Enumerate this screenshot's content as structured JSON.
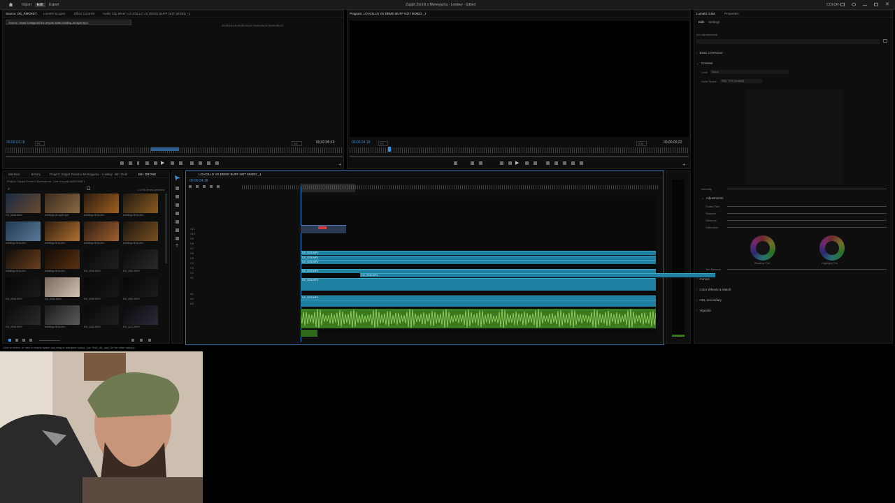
{
  "topbar": {
    "menu": [
      "Import",
      "Edit",
      "Export"
    ],
    "active_menu": "Edit",
    "title": "Zappit Zonnit x Moneyjuma - Lowkey - Edited",
    "right_label": "COLOR"
  },
  "source_monitor": {
    "tabs": [
      "Source: DB_RMOKEY",
      "Lumetri Scopes",
      "Effect Controls",
      "Audio Clip Mixer: LO KOLLO VS DEMO BUFF NOT MIXED _1"
    ],
    "active_tab": "Source: DB_RMOKEY",
    "path": "Source: visual footage/all-the-empire-state-building-at-night.mp4",
    "top_timecodes": "00;00;04;16   00;00;04;20   00;00;04;24   00;00;05;02",
    "timecode_left": "00;02;03;18",
    "fit": "Fit",
    "fraction": "1/4",
    "timecode_right": "00;02;05;13"
  },
  "program_monitor": {
    "tab": "Program: LO KOLLO VS DEMO BUFF NOT MIXED _1",
    "timecode_left": "00;00;24;18",
    "fit": "Fit",
    "fraction": "Full",
    "timecode_right": "00;00;00;22"
  },
  "lumetri": {
    "tabs": [
      "Lumetri Color",
      "Properties"
    ],
    "subtabs": [
      "Edit",
      "Settings"
    ],
    "no_clip": "(no clip selected)",
    "sections": [
      "Basic Correction",
      "Creative",
      "Curves",
      "Color Wheels & Match",
      "HSL Secondary",
      "Vignette"
    ],
    "look_label": "Look",
    "look_value": "None",
    "color_space_label": "Color Space",
    "color_space_value": "Rec. 709 (Default)",
    "intensity_label": "Intensity",
    "adjustments_label": "Adjustments",
    "sliders": [
      "Faded Film",
      "Sharpen",
      "Vibrance",
      "Saturation"
    ],
    "wheels": [
      "Shadow Tint",
      "Highlight Tint"
    ],
    "tint_balance": "Tint Balance"
  },
  "project": {
    "tabs": [
      "Markers",
      "History",
      "Project: Zappit Zonnit x Moneyjuma - Lowkey",
      "Bin: Droll",
      "Bin: DRONE"
    ],
    "active_tab": "Bin: DRONE",
    "path": "Project: Zappit Zonnit x Moneyjuma - Low Key.prproj\\DRONE 1",
    "count": "1 of 95 items selected",
    "items": [
      "DJI_0346.MOV",
      "buildings-at-night.mp4",
      "buildings-lit-by-the...",
      "buildings-lit-by-the...",
      "buildings-lit-by-the...",
      "buildings-lit-by-the...",
      "buildings-lit-by-the...",
      "buildings-lit-by-the...",
      "buildings-lit-by-the...",
      "buildings-lit-by-the...",
      "DJI_0946.MOV",
      "DJI_0461.MOV",
      "DJI_0946.MOV",
      "DJI_0950.MOV",
      "DJI_0949.MOV",
      "DJI_0451.MOV",
      "DJI_0946.MOV",
      "buildings-lit-by-the...",
      "DJI_0453.MOV",
      "DJI_0471.MOV"
    ]
  },
  "timeline": {
    "tab": "LO KOLLO VS DEMO BUFF NOT MIXED _1",
    "timecode": "00;00;24;18",
    "clips": [
      "DJI_0226.MP4",
      "DJI_0226.MP4",
      "DJI_0226.MP4",
      "DJI_0226.MP4",
      "DJI_0226.MP4",
      "DJI_0226.MP4",
      "DJI_0226.MP4"
    ],
    "track_labels": [
      "V11",
      "V10",
      "V9",
      "V8",
      "V7",
      "V6",
      "V5",
      "V4",
      "V3",
      "V2",
      "V1",
      "A1",
      "A2",
      "A3"
    ],
    "audio_track_name": "Audio 1"
  },
  "status_bar": "Click to select, or click in empty space and drag to marquee select. Use Shift, Alt, and Ctrl for other options.",
  "colors": {
    "accent": "#3d8fe0",
    "video_clip": "#1f7fa0",
    "audio_clip": "#3a7a1f"
  }
}
